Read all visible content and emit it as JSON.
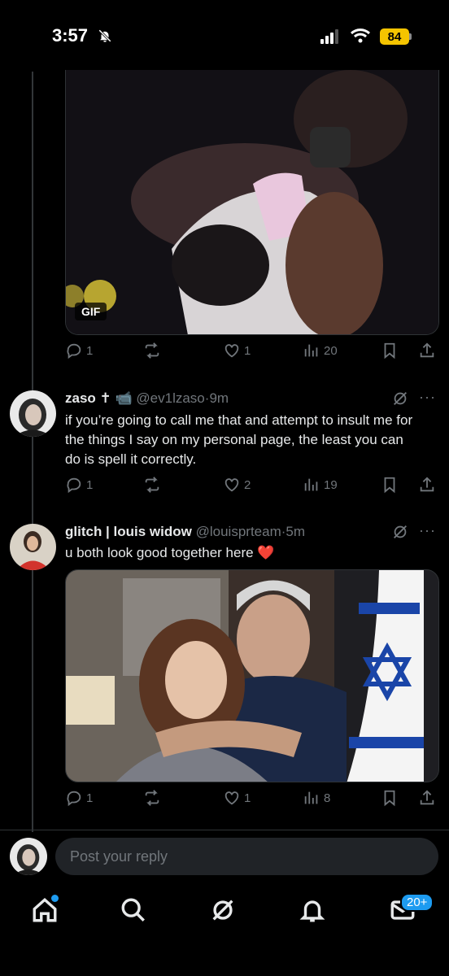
{
  "status_bar": {
    "time": "3:57",
    "battery": "84"
  },
  "gif_post": {
    "badge": "GIF",
    "replies": "1",
    "retweets": "",
    "likes": "1",
    "views": "20"
  },
  "tweets": [
    {
      "name": "zaso",
      "name_emoji": "✝ 📹",
      "handle": "@ev1lzaso",
      "time": "9m",
      "text": "if you’re going to call me that and attempt to insult me for the things I say on my personal page, the least you can do is spell it correctly.",
      "replies": "1",
      "likes": "2",
      "views": "19"
    },
    {
      "name": "glitch | louis widow",
      "handle": "@louisprteam",
      "time": "5m",
      "text": "u both look good together here",
      "text_emoji": "❤️",
      "replies": "1",
      "likes": "1",
      "views": "8"
    }
  ],
  "reply_box": {
    "placeholder": "Post your reply"
  },
  "nav": {
    "messages_badge": "20+"
  },
  "colors": {
    "accent": "#1d9bf0",
    "muted": "#71767b",
    "battery": "#f5c400",
    "heart": "#e0245e"
  },
  "icons": [
    "bell-slash-icon",
    "signal-icon",
    "wifi-icon",
    "reply-icon",
    "retweet-icon",
    "heart-icon",
    "views-icon",
    "bookmark-icon",
    "share-icon",
    "grok-icon",
    "more-icon",
    "home-icon",
    "search-icon",
    "grok-nav-icon",
    "notifications-icon",
    "messages-icon"
  ]
}
